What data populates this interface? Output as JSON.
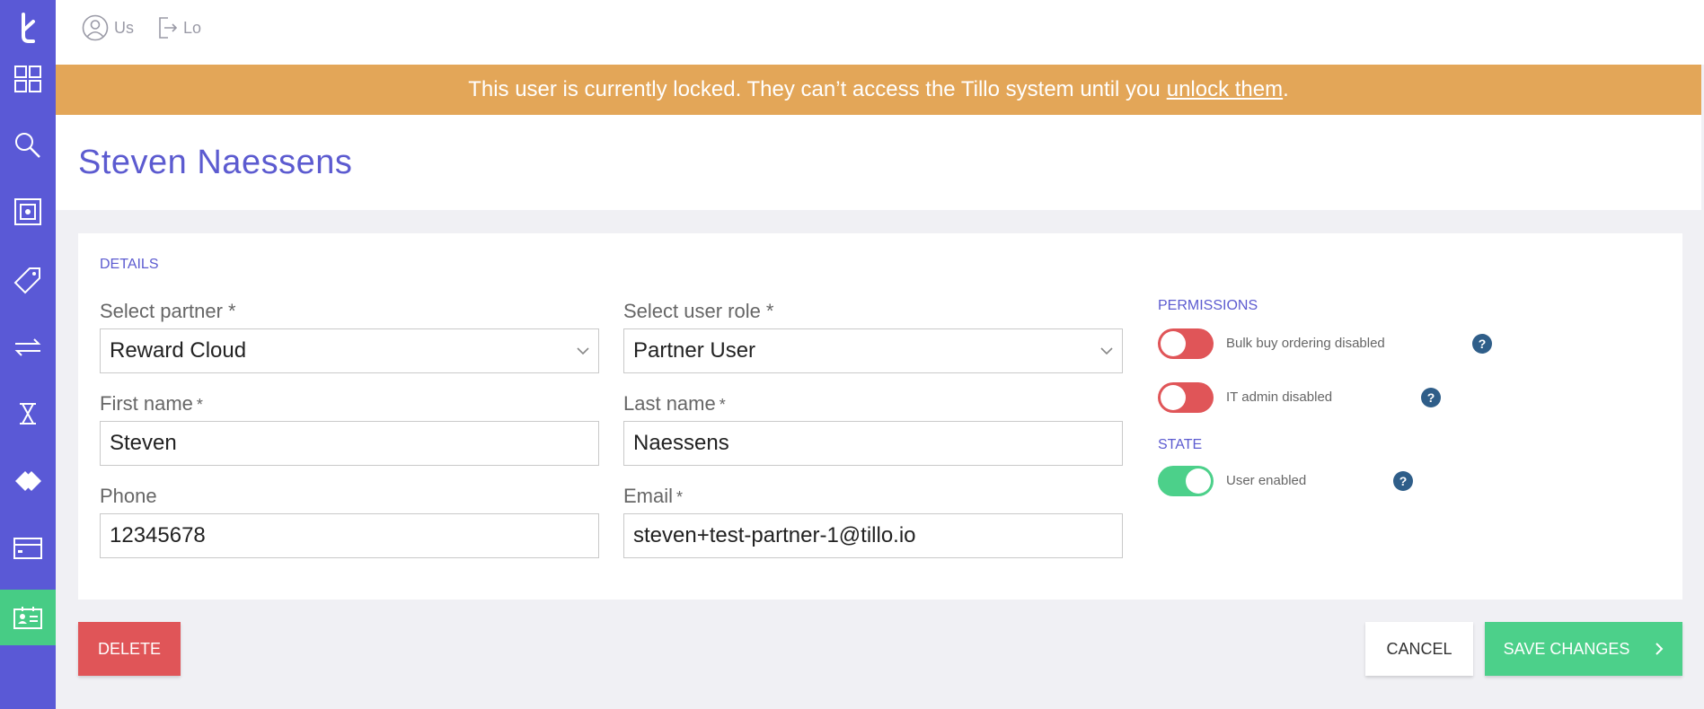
{
  "topbar": {
    "user_label": "Us",
    "logout_label": "Lo"
  },
  "banner": {
    "text": "This user is currently locked. They can’t access the Tillo system until you",
    "link": "unlock them",
    "end": "."
  },
  "page": {
    "title": "Steven Naessens"
  },
  "details": {
    "section_label": "DETAILS",
    "partner": {
      "label": "Select partner",
      "required": "*",
      "value": "Reward Cloud"
    },
    "role": {
      "label": "Select user role",
      "required": "*",
      "value": "Partner User"
    },
    "first_name": {
      "label": "First name",
      "required": "*",
      "value": "Steven"
    },
    "last_name": {
      "label": "Last name",
      "required": "*",
      "value": "Naessens"
    },
    "phone": {
      "label": "Phone",
      "value": "12345678"
    },
    "email": {
      "label": "Email",
      "required": "*",
      "value": "steven+test-partner-1@tillo.io"
    }
  },
  "permissions": {
    "section_label": "PERMISSIONS",
    "items": [
      {
        "label": "Bulk buy ordering disabled",
        "enabled": false
      },
      {
        "label": "IT admin disabled",
        "enabled": false
      }
    ]
  },
  "state": {
    "section_label": "STATE",
    "item": {
      "label": "User enabled",
      "enabled": true
    }
  },
  "help_glyph": "?",
  "buttons": {
    "delete": "DELETE",
    "cancel": "CANCEL",
    "save": "SAVE CHANGES"
  },
  "colors": {
    "sidebar": "#5a59d6",
    "sidebar_active": "#47cc85",
    "banner": "#e3a658",
    "title": "#5c5bd0",
    "danger": "#e05558",
    "success": "#4cd08a",
    "help": "#2f5e89"
  },
  "sidebar_icons": [
    "tillo-logo-icon",
    "dashboard-icon",
    "search-icon",
    "orders-icon",
    "tag-icon",
    "transfer-icon",
    "hourglass-icon",
    "diamond-icon",
    "card-icon",
    "user-card-icon"
  ]
}
